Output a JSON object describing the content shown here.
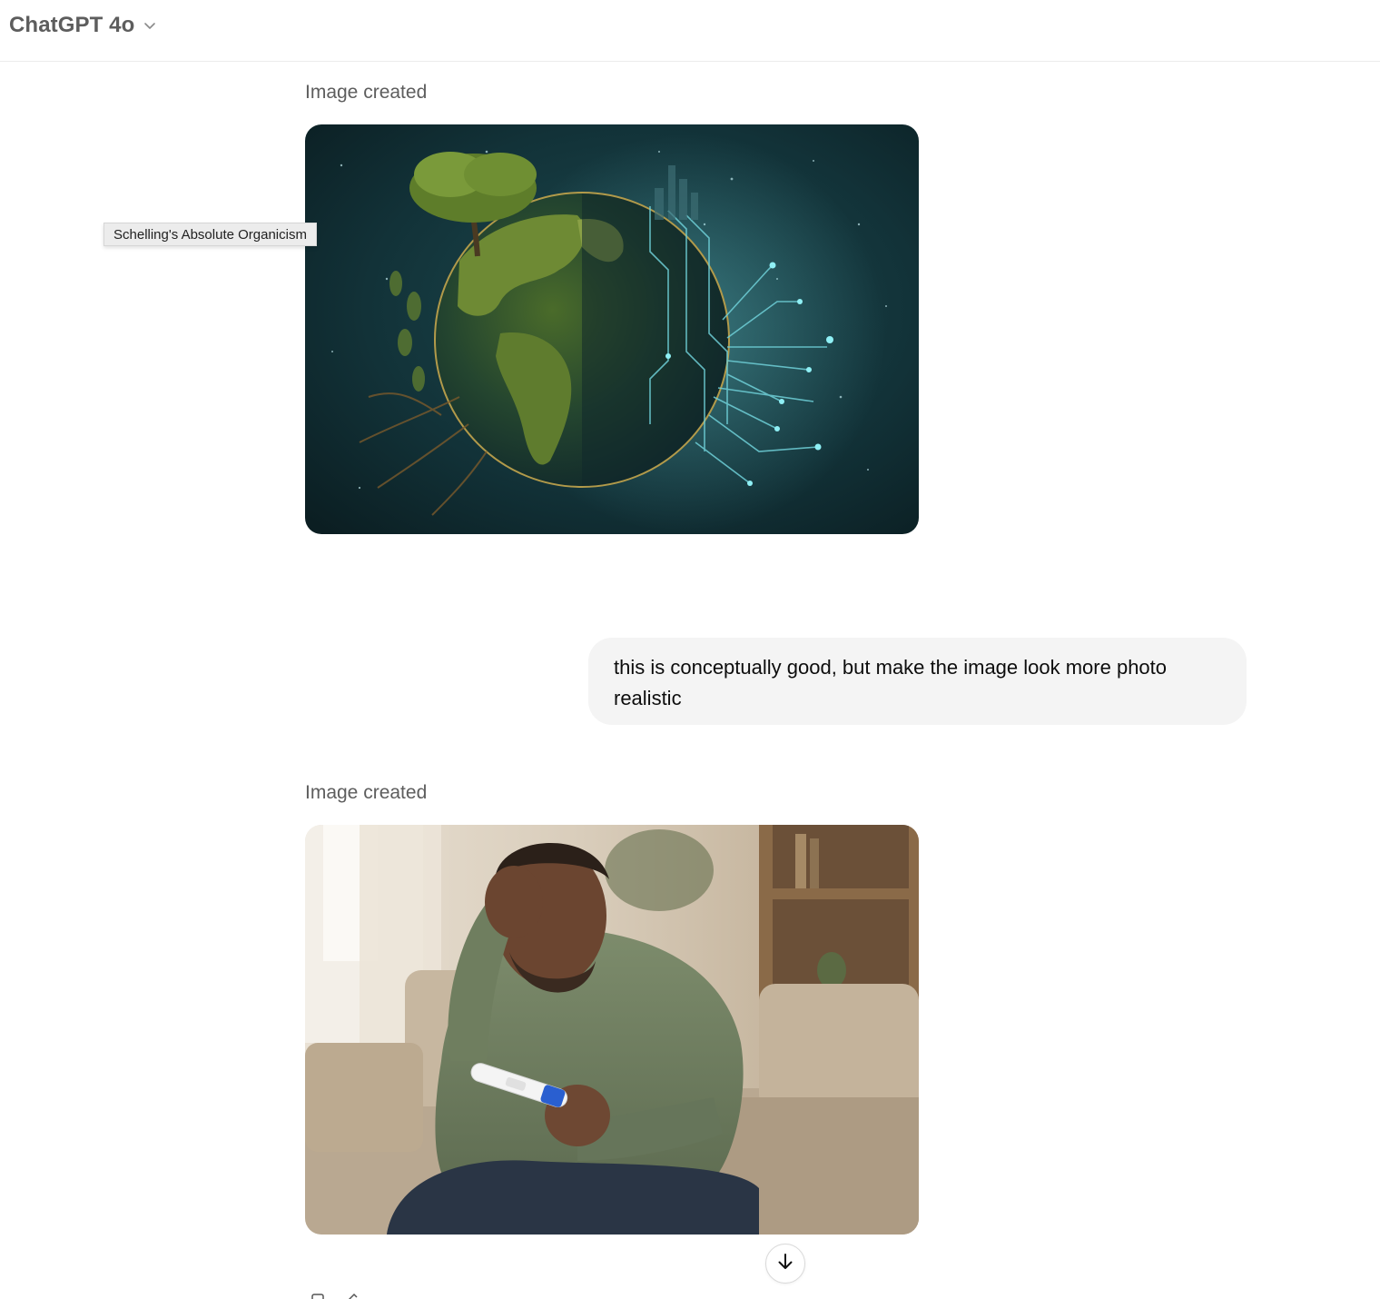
{
  "header": {
    "model_name": "ChatGPT 4o",
    "dropdown_icon": "chevron-down-icon"
  },
  "tooltip": {
    "text": "Schelling's Absolute Organicism"
  },
  "messages": [
    {
      "role": "assistant",
      "label": "Image created",
      "image": "illustration of Earth half covered in forest and a tree, half in glowing circuit lines"
    },
    {
      "role": "user",
      "text": "this is conceptually good, but make the image look more photo realistic"
    },
    {
      "role": "assistant",
      "label": "Image created",
      "image": "photo of a worried man on a sofa holding a pregnancy test"
    }
  ],
  "controls": {
    "scroll_down_icon": "arrow-down-icon",
    "copy_icon": "copy-icon",
    "edit_icon": "edit-icon"
  },
  "colors": {
    "bubble_bg": "#f4f4f4",
    "label_text": "#5d5d5d",
    "earth_bg": "#123238",
    "circuit": "#6fd0d8"
  }
}
